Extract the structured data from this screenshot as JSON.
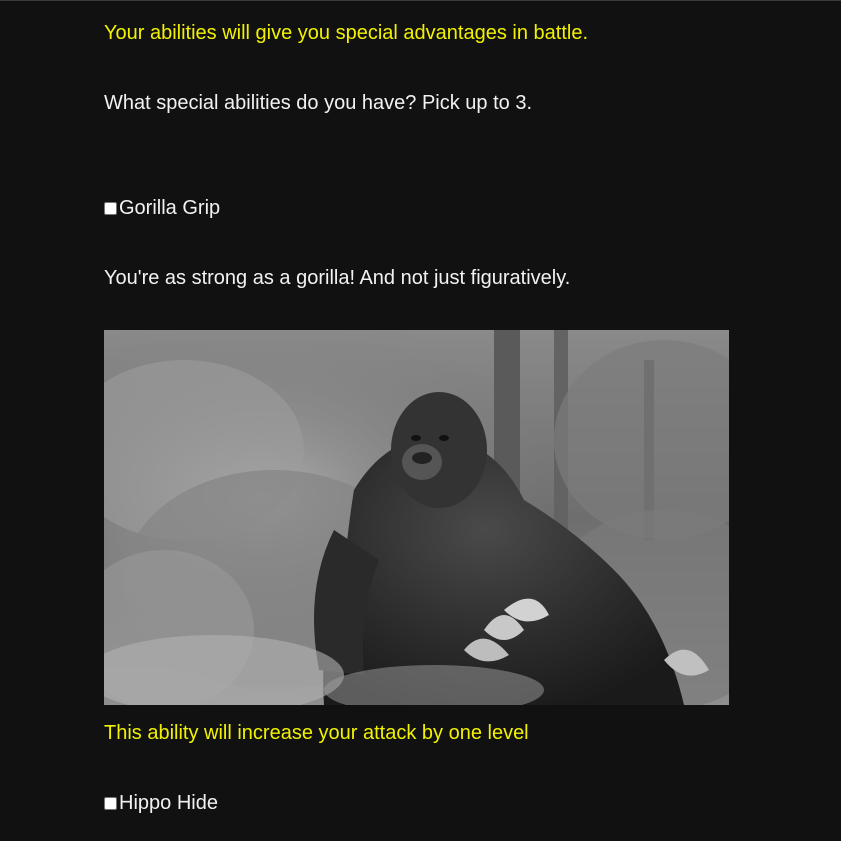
{
  "intro": {
    "note": "Your abilities will give you special advantages in battle.",
    "question": "What special abilities do you have? Pick up to 3."
  },
  "abilities": [
    {
      "label": "Gorilla Grip",
      "description": "You're as strong as a gorilla! And not just figuratively.",
      "image_icon": "gorilla-photo",
      "effect": "This ability will increase your attack by one level",
      "checked": false
    },
    {
      "label": "Hippo Hide",
      "checked": false
    }
  ],
  "colors": {
    "background": "#111111",
    "highlight_text": "#f2f200",
    "body_text": "#f2f2f2"
  }
}
